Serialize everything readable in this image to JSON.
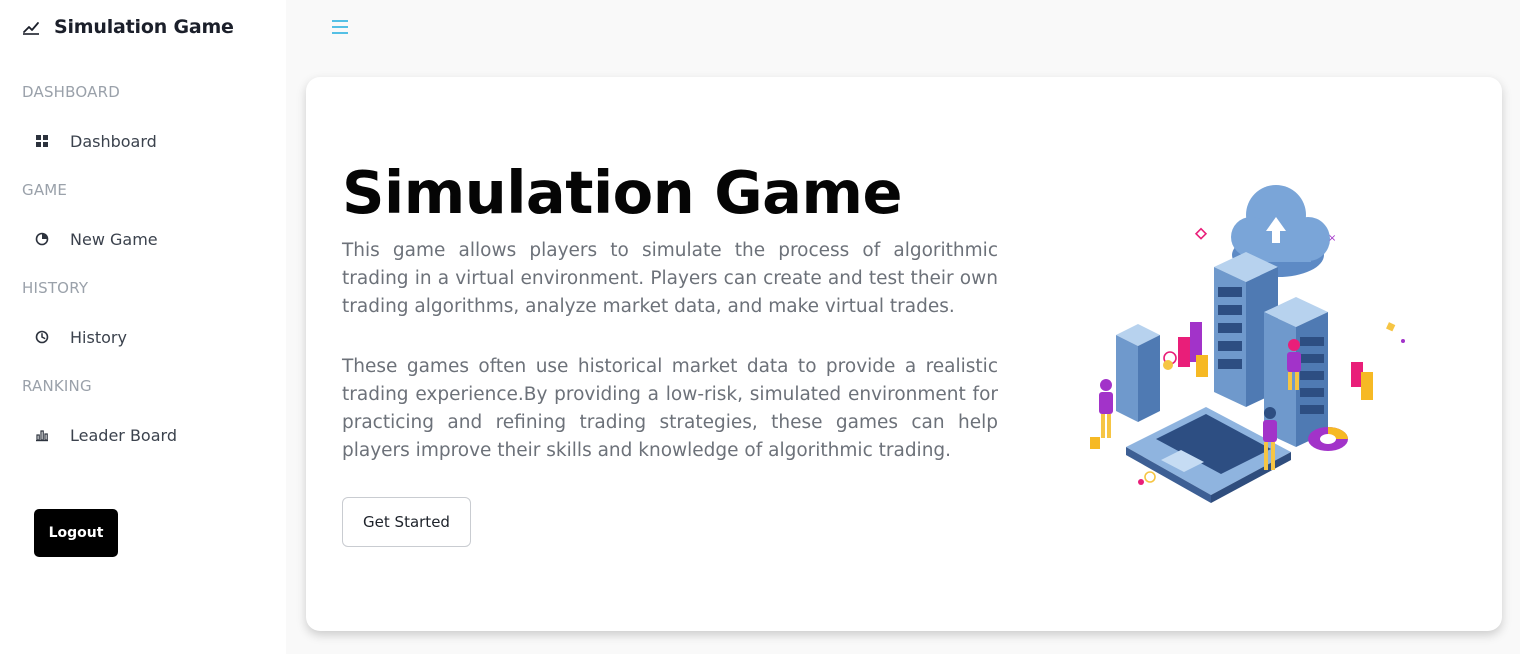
{
  "sidebar": {
    "brand_title": "Simulation Game",
    "brand_icon": "chart-line-icon",
    "sections": [
      {
        "label": "DASHBOARD",
        "items": [
          {
            "label": "Dashboard",
            "icon": "grid-icon"
          }
        ]
      },
      {
        "label": "GAME",
        "items": [
          {
            "label": "New Game",
            "icon": "pie-chart-icon"
          }
        ]
      },
      {
        "label": "HISTORY",
        "items": [
          {
            "label": "History",
            "icon": "clock-icon"
          }
        ]
      },
      {
        "label": "RANKING",
        "items": [
          {
            "label": "Leader Board",
            "icon": "bar-chart-icon"
          }
        ]
      }
    ],
    "logout_label": "Logout"
  },
  "topbar": {
    "menu_icon": "hamburger-menu-icon",
    "accent": "#2ab1e0"
  },
  "hero": {
    "title": "Simulation Game",
    "paragraph1": "This game allows players to simulate the process of algorithmic trading in a virtual environment. Players can create and test their own trading algorithms, analyze market data, and make virtual trades.",
    "paragraph2": "These games often use historical market data to provide a realistic trading experience.By providing a low-risk, simulated environment for practicing and refining trading strategies, these games can help players improve their skills and knowledge of algorithmic trading.",
    "cta_label": "Get Started"
  },
  "colors": {
    "background": "#f9f9f9",
    "sidebar": "#ffffff",
    "primary_text": "#050505",
    "muted_text": "#6c7179",
    "logout_bg": "#000000"
  }
}
